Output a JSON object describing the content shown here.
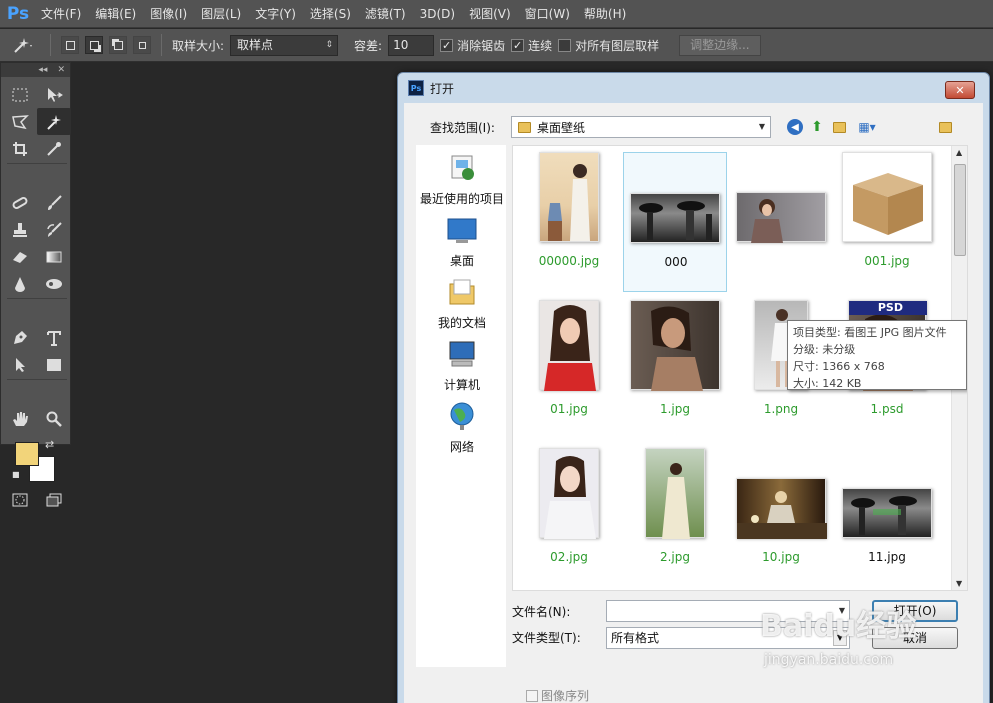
{
  "app": {
    "logo": "Ps"
  },
  "menubar": {
    "items": [
      "文件(F)",
      "编辑(E)",
      "图像(I)",
      "图层(L)",
      "文字(Y)",
      "选择(S)",
      "滤镜(T)",
      "3D(D)",
      "视图(V)",
      "窗口(W)",
      "帮助(H)"
    ]
  },
  "options": {
    "sample_size_label": "取样大小:",
    "sample_size_value": "取样点",
    "tolerance_label": "容差:",
    "tolerance_value": "10",
    "antialias_label": "消除锯齿",
    "antialias_checked": true,
    "contiguous_label": "连续",
    "contiguous_checked": true,
    "all_layers_label": "对所有图层取样",
    "all_layers_checked": false,
    "refine_edge_label": "调整边缘..."
  },
  "tools_panel": {
    "collapse": "◂◂",
    "close": "✕"
  },
  "colors": {
    "foreground": "#f2d47a",
    "background": "#ffffff"
  },
  "dialog": {
    "title": "打开",
    "lookin_label": "查找范围(I):",
    "lookin_value": "桌面壁纸",
    "places": [
      {
        "label": "最近使用的项目",
        "icon": "recent-items-icon"
      },
      {
        "label": "桌面",
        "icon": "desktop-icon"
      },
      {
        "label": "我的文档",
        "icon": "documents-icon"
      },
      {
        "label": "计算机",
        "icon": "computer-icon"
      },
      {
        "label": "网络",
        "icon": "network-icon"
      }
    ],
    "files": [
      {
        "name": "00000.jpg"
      },
      {
        "name": "000"
      },
      {
        "name": ""
      },
      {
        "name": "001.jpg"
      },
      {
        "name": "01.jpg"
      },
      {
        "name": "1.jpg"
      },
      {
        "name": "1.png"
      },
      {
        "name": "1.psd",
        "badge": "PSD"
      },
      {
        "name": "02.jpg"
      },
      {
        "name": "2.jpg"
      },
      {
        "name": "10.jpg"
      },
      {
        "name": "11.jpg"
      }
    ],
    "tooltip": {
      "type": "项目类型: 看图王 JPG 图片文件",
      "rating": "分级: 未分级",
      "size": "尺寸: 1366 x 768",
      "filesize": "大小: 142 KB"
    },
    "filename_label": "文件名(N):",
    "filename_value": "",
    "filetype_label": "文件类型(T):",
    "filetype_value": "所有格式",
    "open_button": "打开(O)",
    "cancel_button": "取消",
    "image_sequence_label": "图像序列"
  },
  "watermark": {
    "text": "Baidu经验",
    "url": "jingyan.baidu.com"
  }
}
